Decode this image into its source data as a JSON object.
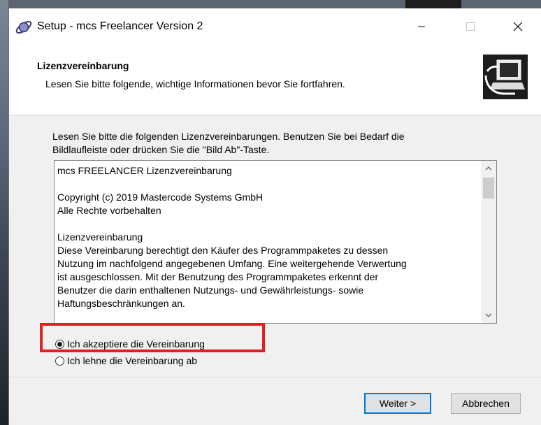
{
  "window": {
    "title": "Setup - mcs Freelancer Version 2"
  },
  "header": {
    "title": "Lizenzvereinbarung",
    "subtitle": "Lesen Sie bitte folgende, wichtige Informationen bevor Sie fortfahren."
  },
  "instructions": {
    "line1": "Lesen Sie bitte die folgenden Lizenzvereinbarungen. Benutzen Sie bei Bedarf die",
    "line2": "Bildlaufleiste oder drücken Sie die \"Bild Ab\"-Taste."
  },
  "license": {
    "lines": [
      "mcs FREELANCER Lizenzvereinbarung",
      "",
      "Copyright (c) 2019 Mastercode Systems GmbH",
      "Alle Rechte vorbehalten",
      "",
      "Lizenzvereinbarung",
      "Diese Vereinbarung berechtigt den Käufer des Programmpaketes zu dessen",
      "Nutzung im nachfolgend angegebenen Umfang. Eine weitergehende Verwertung",
      "ist ausgeschlossen. Mit der Benutzung des Programmpaketes erkennt der",
      "Benutzer die darin enthaltenen Nutzungs- und Gewährleistungs- sowie",
      "Haftungsbeschränkungen an."
    ]
  },
  "options": {
    "accept_label": "Ich akzeptiere die Vereinbarung",
    "accept_selected": true,
    "decline_label": "Ich lehne die Vereinbarung ab",
    "decline_selected": false
  },
  "buttons": {
    "next_label": "Weiter >",
    "cancel_label": "Abbrechen"
  },
  "colors": {
    "highlight": "#e31e24",
    "default_button_border": "#0078d7"
  },
  "icons": {
    "app": "planet-icon",
    "header": "computer-install-icon",
    "minimize": "minimize-icon",
    "maximize": "maximize-icon",
    "close": "close-icon"
  }
}
